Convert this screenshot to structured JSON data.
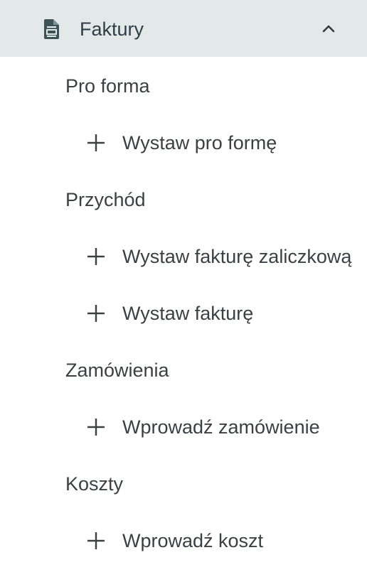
{
  "header": {
    "title": "Faktury",
    "icon": "invoice-document-icon",
    "toggle_icon": "chevron-up-icon",
    "background": "#e3e8e8"
  },
  "sections": [
    {
      "label": "Pro forma",
      "actions": [
        {
          "icon": "plus-icon",
          "label": "Wystaw pro formę"
        }
      ]
    },
    {
      "label": "Przychód",
      "actions": [
        {
          "icon": "plus-icon",
          "label": "Wystaw fakturę zaliczkową"
        },
        {
          "icon": "plus-icon",
          "label": "Wystaw fakturę"
        }
      ]
    },
    {
      "label": "Zamówienia",
      "actions": [
        {
          "icon": "plus-icon",
          "label": "Wprowadź zamówienie"
        }
      ]
    },
    {
      "label": "Koszty",
      "actions": [
        {
          "icon": "plus-icon",
          "label": "Wprowadź koszt"
        }
      ]
    }
  ]
}
